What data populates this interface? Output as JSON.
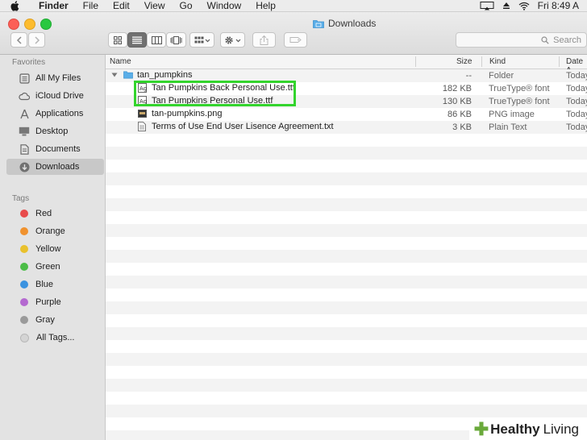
{
  "menubar": {
    "app_name": "Finder",
    "menus": [
      "File",
      "Edit",
      "View",
      "Go",
      "Window",
      "Help"
    ],
    "clock": "Fri 8:49 A"
  },
  "window": {
    "title": "Downloads"
  },
  "search": {
    "placeholder": "Search"
  },
  "sidebar": {
    "favorites_label": "Favorites",
    "favorites": [
      {
        "label": "All My Files",
        "icon": "all-files-icon"
      },
      {
        "label": "iCloud Drive",
        "icon": "cloud-icon"
      },
      {
        "label": "Applications",
        "icon": "applications-icon"
      },
      {
        "label": "Desktop",
        "icon": "desktop-icon"
      },
      {
        "label": "Documents",
        "icon": "documents-icon"
      },
      {
        "label": "Downloads",
        "icon": "downloads-icon",
        "selected": true
      }
    ],
    "tags_label": "Tags",
    "tags": [
      {
        "label": "Red",
        "color": "#e84b4b"
      },
      {
        "label": "Orange",
        "color": "#f0922e"
      },
      {
        "label": "Yellow",
        "color": "#e9c12d"
      },
      {
        "label": "Green",
        "color": "#4cbd47"
      },
      {
        "label": "Blue",
        "color": "#3b93e0"
      },
      {
        "label": "Purple",
        "color": "#b469d0"
      },
      {
        "label": "Gray",
        "color": "#9a9a9a"
      },
      {
        "label": "All Tags...",
        "color": "#d4d4d4"
      }
    ]
  },
  "columns": {
    "name": "Name",
    "size": "Size",
    "kind": "Kind",
    "date": "Date A"
  },
  "files": [
    {
      "name": "tan_pumpkins",
      "size": "--",
      "kind": "Folder",
      "date": "Today",
      "icon": "folder-icon"
    },
    {
      "name": "Tan Pumpkins Back Personal Use.ttf",
      "size": "182 KB",
      "kind": "TrueType® font",
      "date": "Today",
      "icon": "font-file-icon"
    },
    {
      "name": "Tan Pumpkins Personal Use.ttf",
      "size": "130 KB",
      "kind": "TrueType® font",
      "date": "Today",
      "icon": "font-file-icon"
    },
    {
      "name": "tan-pumpkins.png",
      "size": "86 KB",
      "kind": "PNG image",
      "date": "Today",
      "icon": "image-file-icon"
    },
    {
      "name": "Terms of Use End User Lisence Agreement.txt",
      "size": "3 KB",
      "kind": "Plain Text",
      "date": "Today",
      "icon": "text-file-icon"
    }
  ],
  "watermark": {
    "word1": "Healthy",
    "word2": "Living"
  },
  "colors": {
    "highlight": "#33d42d",
    "folder": "#5aaee8"
  }
}
